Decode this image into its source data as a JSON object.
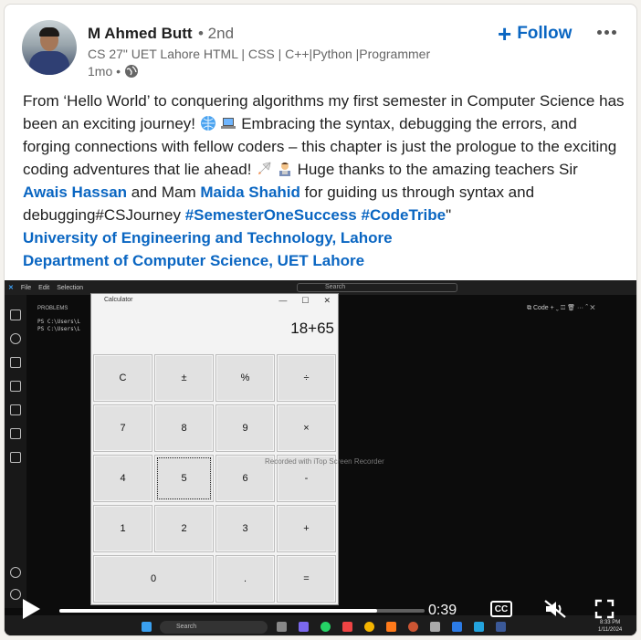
{
  "author": {
    "name": "M Ahmed Butt",
    "degree": "• 2nd",
    "headline": "CS 27\" UET Lahore HTML | CSS | C++|Python |Programmer",
    "time": "1mo •",
    "visibility_icon": "globe-icon"
  },
  "actions": {
    "follow_label": "Follow",
    "follow_icon": "plus-icon",
    "more_icon": "ellipsis-icon"
  },
  "post": {
    "p1": "From ‘Hello World’ to conquering algorithms my first semester in Computer Science has been an exciting journey! ",
    "p2": " Embracing the syntax, debugging the errors, and forging connections with fellow coders – this chapter is just the prologue to the exciting coding adventures that lie ahead! ",
    "p3": " Huge thanks to the amazing teachers Sir ",
    "mention1": "Awais Hassan",
    "p4": " and Mam ",
    "mention2": "Maida Shahid",
    "p5": " for guiding us through syntax and debugging#CSJourney ",
    "tag1": "#SemesterOneSuccess",
    "tag2": "#CodeTribe",
    "p6": "\"",
    "org1": "University of Engineering and Technology, Lahore",
    "org2": "Department of Computer Science, UET Lahore",
    "accent_color": "#0a66c2"
  },
  "video": {
    "calculator_title": "Calculator",
    "display": "18+65",
    "buttons": [
      "C",
      "±",
      "%",
      "÷",
      "7",
      "8",
      "9",
      "×",
      "4",
      "5",
      "6",
      "-",
      "1",
      "2",
      "3",
      "+",
      "0",
      ".",
      "="
    ],
    "recorder_watermark": "Recorded with iTop Screen Recorder",
    "editor_search": "Search",
    "editor_menu": [
      "File",
      "Edit",
      "Selection"
    ],
    "panel_header": "PROBLEMS",
    "terminal_lines": [
      "PS C:\\Users\\L",
      "PS C:\\Users\\L"
    ],
    "taskbar_search": "Search",
    "taskbar_time": "8:33 PM",
    "taskbar_date": "1/11/2024",
    "right_tool_label": "Code",
    "current_time": "0:39",
    "progress": 0.87,
    "cc_label": "CC",
    "play_icon": "play-icon",
    "mute_icon": "mute-icon",
    "fullscreen_icon": "fullscreen-icon"
  }
}
